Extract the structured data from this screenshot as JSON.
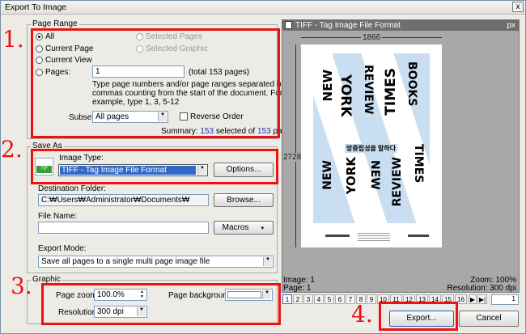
{
  "window": {
    "title": "Export To Image",
    "close": "x"
  },
  "page_range": {
    "legend": "Page Range",
    "all": "All",
    "current_page": "Current Page",
    "current_view": "Current View",
    "pages": "Pages:",
    "selected_pages": "Selected Pages",
    "selected_graphic": "Selected Graphic",
    "pages_value": "1",
    "total": "(total 153 pages)",
    "hint": [
      "Type page numbers and/or page ranges separated by",
      "commas counting from the start of the document. For",
      "example, type 1, 3, 5-12"
    ],
    "subset_label": "Subset:",
    "subset_value": "All pages",
    "reverse_order": "Reverse Order",
    "summary_prefix": "Summary:",
    "summary_selected": "153",
    "summary_mid": "selected of",
    "summary_total": "153",
    "summary_suffix": "pages"
  },
  "save_as": {
    "legend": "Save As",
    "image_type_label": "Image Type:",
    "image_type_value": "TIFF - Tag Image File Format",
    "options": "Options...",
    "icon_text": "TIF",
    "dest_label": "Destination Folder:",
    "dest_value": "C:₩Users₩Administrator₩Documents₩",
    "browse": "Browse...",
    "filename_label": "File Name:",
    "filename_value": "",
    "macros": "Macros",
    "export_mode_label": "Export Mode:",
    "export_mode_value": "Save all pages to a single multi page image file"
  },
  "graphic": {
    "legend": "Graphic",
    "zoom_label": "Page zoom:",
    "zoom_value": "100.0%",
    "resolution_label": "Resolution:",
    "resolution_value": "300 dpi",
    "background_label": "Page background:"
  },
  "preview": {
    "header": "TIFF - Tag Image File Format",
    "unit": "px",
    "width": "1866",
    "height": "2728",
    "poster_words": [
      "NEW",
      "YORK",
      "REVIEW",
      "TIMES",
      "BOOKS"
    ],
    "poster_korean": "망중립성을 말하다",
    "image_info": "Image: 1",
    "page_info": "Page: 1",
    "zoom_info": "Zoom: 100%",
    "res_info": "Resolution: 300 dpi",
    "page_numbers": [
      "1",
      "2",
      "3",
      "4",
      "5",
      "6",
      "7",
      "8",
      "9",
      "10",
      "11",
      "12",
      "13",
      "14",
      "15",
      "16"
    ],
    "page_input": "1"
  },
  "actions": {
    "export": "Export...",
    "cancel": "Cancel"
  },
  "annotations": [
    "1.",
    "2.",
    "3.",
    "4."
  ],
  "colors": {
    "annotation_red": "#ee1111",
    "selection_blue": "#3169c6",
    "poster_bg": "#c9dff1",
    "summary_blue": "#2233aa"
  }
}
